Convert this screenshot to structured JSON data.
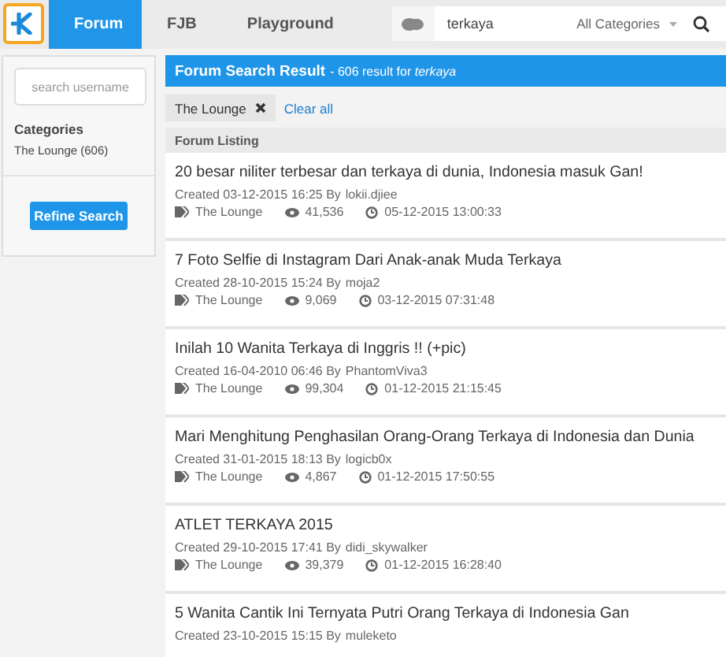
{
  "nav": {
    "tabs": [
      {
        "label": "Forum",
        "selected": true
      },
      {
        "label": "FJB",
        "selected": false
      },
      {
        "label": "Playground",
        "selected": false
      }
    ],
    "search": {
      "value": "terkaya",
      "category": "All Categories"
    }
  },
  "sidebar": {
    "username_placeholder": "search username",
    "categories_heading": "Categories",
    "categories": [
      "The Lounge (606)"
    ],
    "refine_button": "Refine Search"
  },
  "results": {
    "title": "Forum Search Result",
    "summary": "- 606 result for *terkaya*",
    "filters": [
      {
        "label": "The Lounge"
      }
    ],
    "clear_all": "Clear all",
    "listing_heading": "Forum Listing",
    "threads": [
      {
        "title": "20 besar niliter terbesar dan terkaya di dunia, Indonesia masuk Gan!",
        "created": "Created 03-12-2015 16:25 By",
        "author": "lokii.djiee",
        "category": "The Lounge",
        "views": "41,536",
        "last_post": "05-12-2015 13:00:33"
      },
      {
        "title": "7 Foto Selfie di Instagram Dari Anak-anak Muda Terkaya",
        "created": "Created 28-10-2015 15:24 By",
        "author": "moja2",
        "category": "The Lounge",
        "views": "9,069",
        "last_post": "03-12-2015 07:31:48"
      },
      {
        "title": "Inilah 10 Wanita Terkaya di Inggris !! (+pic)",
        "created": "Created 16-04-2010 06:46 By",
        "author": "PhantomViva3",
        "category": "The Lounge",
        "views": "99,304",
        "last_post": "01-12-2015 21:15:45"
      },
      {
        "title": "Mari Menghitung Penghasilan Orang-Orang Terkaya di Indonesia dan Dunia",
        "created": "Created 31-01-2015 18:13 By",
        "author": "logicb0x",
        "category": "The Lounge",
        "views": "4,867",
        "last_post": "01-12-2015 17:50:55"
      },
      {
        "title": "ATLET TERKAYA 2015",
        "created": "Created 29-10-2015 17:41 By",
        "author": "didi_skywalker",
        "category": "The Lounge",
        "views": "39,379",
        "last_post": "01-12-2015 16:28:40"
      },
      {
        "title": "5 Wanita Cantik Ini Ternyata Putri Orang Terkaya di Indonesia Gan",
        "created": "Created 23-10-2015 15:15 By",
        "author": "muleketo"
      }
    ]
  }
}
